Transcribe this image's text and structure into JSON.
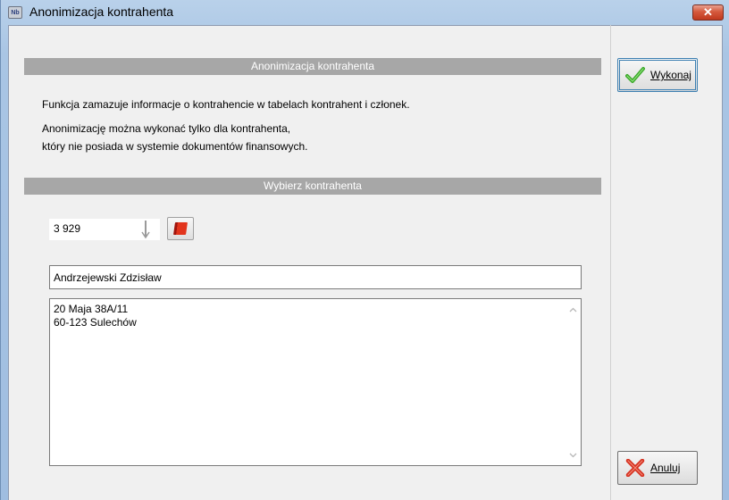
{
  "window": {
    "title": "Anonimizacja kontrahenta",
    "app_icon_text": "Nb",
    "close_glyph": "✕"
  },
  "sections": {
    "anonymization_header": "Anonimizacja kontrahenta",
    "select_header": "Wybierz kontrahenta"
  },
  "description": {
    "line1": "Funkcja zamazuje informacje o kontrahencie w tabelach kontrahent i członek.",
    "line2": "Anonimizację można wykonać tylko dla kontrahenta,",
    "line3": "który nie posiada w systemie dokumentów finansowych."
  },
  "form": {
    "contractor_id": "3 929",
    "contractor_name": "Andrzejewski Zdzisław",
    "address_line1": "20 Maja 38A/11",
    "address_line2": "60-123 Sulechów"
  },
  "buttons": {
    "execute_label": "Wykonaj",
    "cancel_label": "Anuluj"
  },
  "icons": {
    "execute": "checkmark-icon",
    "cancel": "cross-icon",
    "lookup": "book-icon",
    "spin": "down-arrow-icon"
  },
  "colors": {
    "section_header_bg": "#a7a7a7",
    "close_button": "#c0391e",
    "check_green": "#3aa82a",
    "cross_red": "#d6301f"
  }
}
